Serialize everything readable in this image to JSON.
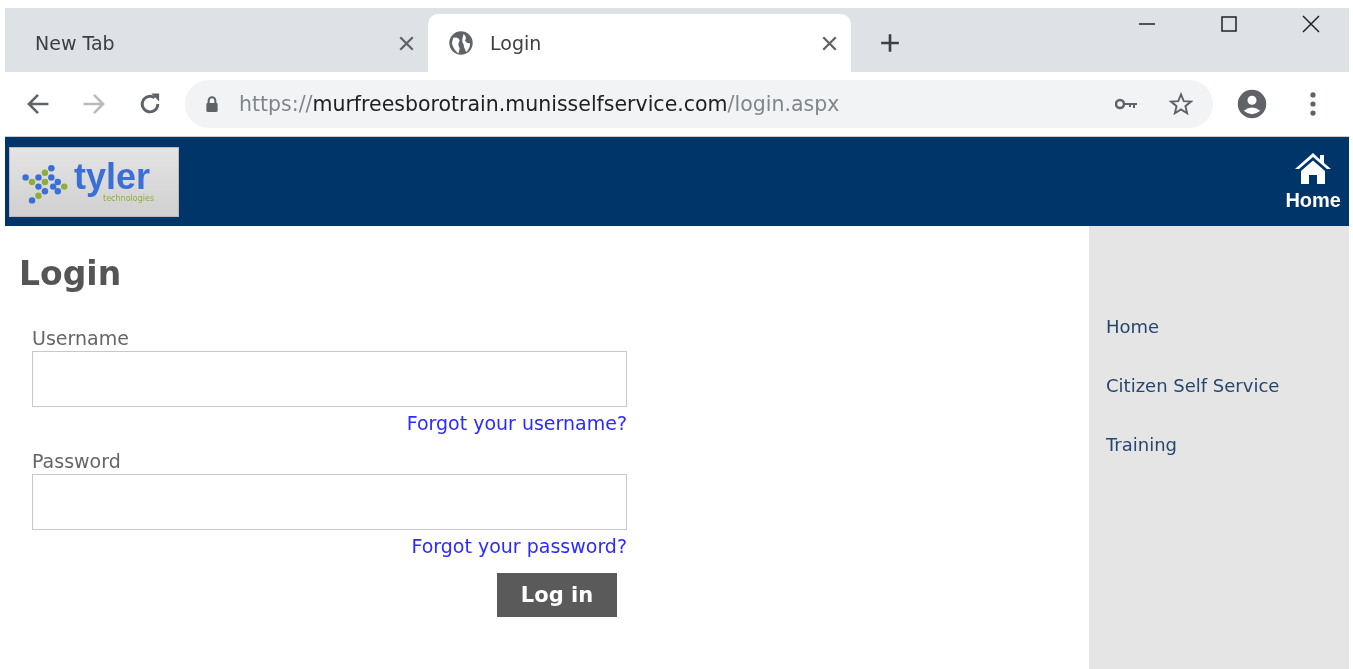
{
  "browser": {
    "tabs": [
      {
        "title": "New Tab",
        "selected": false,
        "has_favicon": false
      },
      {
        "title": "Login",
        "selected": true,
        "has_favicon": true
      }
    ],
    "address": {
      "scheme": "https://",
      "host": "murfreesborotrain.munisselfservice.com",
      "path": "/login.aspx"
    },
    "forward_disabled": true
  },
  "header": {
    "logo": {
      "name": "tyler",
      "tagline": "technologies"
    },
    "home_label": "Home"
  },
  "login": {
    "title": "Login",
    "fields": [
      {
        "label": "Username",
        "link": "Forgot your username?"
      },
      {
        "label": "Password",
        "link": "Forgot your password?"
      }
    ],
    "submit": "Log in"
  },
  "sidebar": {
    "items": [
      "Home",
      "Citizen Self Service",
      "Training"
    ]
  }
}
